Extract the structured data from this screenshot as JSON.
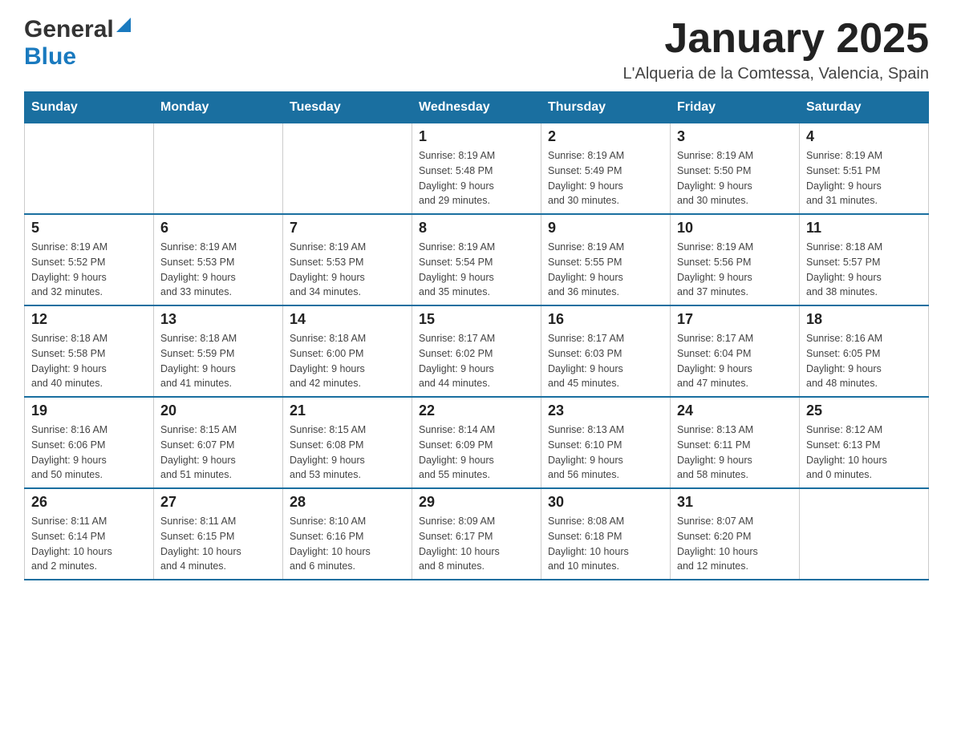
{
  "header": {
    "logo": {
      "general": "General",
      "blue": "Blue",
      "arrow": "▶"
    },
    "title": "January 2025",
    "subtitle": "L'Alqueria de la Comtessa, Valencia, Spain"
  },
  "calendar": {
    "days_of_week": [
      "Sunday",
      "Monday",
      "Tuesday",
      "Wednesday",
      "Thursday",
      "Friday",
      "Saturday"
    ],
    "weeks": [
      {
        "days": [
          {
            "number": "",
            "info": ""
          },
          {
            "number": "",
            "info": ""
          },
          {
            "number": "",
            "info": ""
          },
          {
            "number": "1",
            "info": "Sunrise: 8:19 AM\nSunset: 5:48 PM\nDaylight: 9 hours\nand 29 minutes."
          },
          {
            "number": "2",
            "info": "Sunrise: 8:19 AM\nSunset: 5:49 PM\nDaylight: 9 hours\nand 30 minutes."
          },
          {
            "number": "3",
            "info": "Sunrise: 8:19 AM\nSunset: 5:50 PM\nDaylight: 9 hours\nand 30 minutes."
          },
          {
            "number": "4",
            "info": "Sunrise: 8:19 AM\nSunset: 5:51 PM\nDaylight: 9 hours\nand 31 minutes."
          }
        ]
      },
      {
        "days": [
          {
            "number": "5",
            "info": "Sunrise: 8:19 AM\nSunset: 5:52 PM\nDaylight: 9 hours\nand 32 minutes."
          },
          {
            "number": "6",
            "info": "Sunrise: 8:19 AM\nSunset: 5:53 PM\nDaylight: 9 hours\nand 33 minutes."
          },
          {
            "number": "7",
            "info": "Sunrise: 8:19 AM\nSunset: 5:53 PM\nDaylight: 9 hours\nand 34 minutes."
          },
          {
            "number": "8",
            "info": "Sunrise: 8:19 AM\nSunset: 5:54 PM\nDaylight: 9 hours\nand 35 minutes."
          },
          {
            "number": "9",
            "info": "Sunrise: 8:19 AM\nSunset: 5:55 PM\nDaylight: 9 hours\nand 36 minutes."
          },
          {
            "number": "10",
            "info": "Sunrise: 8:19 AM\nSunset: 5:56 PM\nDaylight: 9 hours\nand 37 minutes."
          },
          {
            "number": "11",
            "info": "Sunrise: 8:18 AM\nSunset: 5:57 PM\nDaylight: 9 hours\nand 38 minutes."
          }
        ]
      },
      {
        "days": [
          {
            "number": "12",
            "info": "Sunrise: 8:18 AM\nSunset: 5:58 PM\nDaylight: 9 hours\nand 40 minutes."
          },
          {
            "number": "13",
            "info": "Sunrise: 8:18 AM\nSunset: 5:59 PM\nDaylight: 9 hours\nand 41 minutes."
          },
          {
            "number": "14",
            "info": "Sunrise: 8:18 AM\nSunset: 6:00 PM\nDaylight: 9 hours\nand 42 minutes."
          },
          {
            "number": "15",
            "info": "Sunrise: 8:17 AM\nSunset: 6:02 PM\nDaylight: 9 hours\nand 44 minutes."
          },
          {
            "number": "16",
            "info": "Sunrise: 8:17 AM\nSunset: 6:03 PM\nDaylight: 9 hours\nand 45 minutes."
          },
          {
            "number": "17",
            "info": "Sunrise: 8:17 AM\nSunset: 6:04 PM\nDaylight: 9 hours\nand 47 minutes."
          },
          {
            "number": "18",
            "info": "Sunrise: 8:16 AM\nSunset: 6:05 PM\nDaylight: 9 hours\nand 48 minutes."
          }
        ]
      },
      {
        "days": [
          {
            "number": "19",
            "info": "Sunrise: 8:16 AM\nSunset: 6:06 PM\nDaylight: 9 hours\nand 50 minutes."
          },
          {
            "number": "20",
            "info": "Sunrise: 8:15 AM\nSunset: 6:07 PM\nDaylight: 9 hours\nand 51 minutes."
          },
          {
            "number": "21",
            "info": "Sunrise: 8:15 AM\nSunset: 6:08 PM\nDaylight: 9 hours\nand 53 minutes."
          },
          {
            "number": "22",
            "info": "Sunrise: 8:14 AM\nSunset: 6:09 PM\nDaylight: 9 hours\nand 55 minutes."
          },
          {
            "number": "23",
            "info": "Sunrise: 8:13 AM\nSunset: 6:10 PM\nDaylight: 9 hours\nand 56 minutes."
          },
          {
            "number": "24",
            "info": "Sunrise: 8:13 AM\nSunset: 6:11 PM\nDaylight: 9 hours\nand 58 minutes."
          },
          {
            "number": "25",
            "info": "Sunrise: 8:12 AM\nSunset: 6:13 PM\nDaylight: 10 hours\nand 0 minutes."
          }
        ]
      },
      {
        "days": [
          {
            "number": "26",
            "info": "Sunrise: 8:11 AM\nSunset: 6:14 PM\nDaylight: 10 hours\nand 2 minutes."
          },
          {
            "number": "27",
            "info": "Sunrise: 8:11 AM\nSunset: 6:15 PM\nDaylight: 10 hours\nand 4 minutes."
          },
          {
            "number": "28",
            "info": "Sunrise: 8:10 AM\nSunset: 6:16 PM\nDaylight: 10 hours\nand 6 minutes."
          },
          {
            "number": "29",
            "info": "Sunrise: 8:09 AM\nSunset: 6:17 PM\nDaylight: 10 hours\nand 8 minutes."
          },
          {
            "number": "30",
            "info": "Sunrise: 8:08 AM\nSunset: 6:18 PM\nDaylight: 10 hours\nand 10 minutes."
          },
          {
            "number": "31",
            "info": "Sunrise: 8:07 AM\nSunset: 6:20 PM\nDaylight: 10 hours\nand 12 minutes."
          },
          {
            "number": "",
            "info": ""
          }
        ]
      }
    ]
  }
}
